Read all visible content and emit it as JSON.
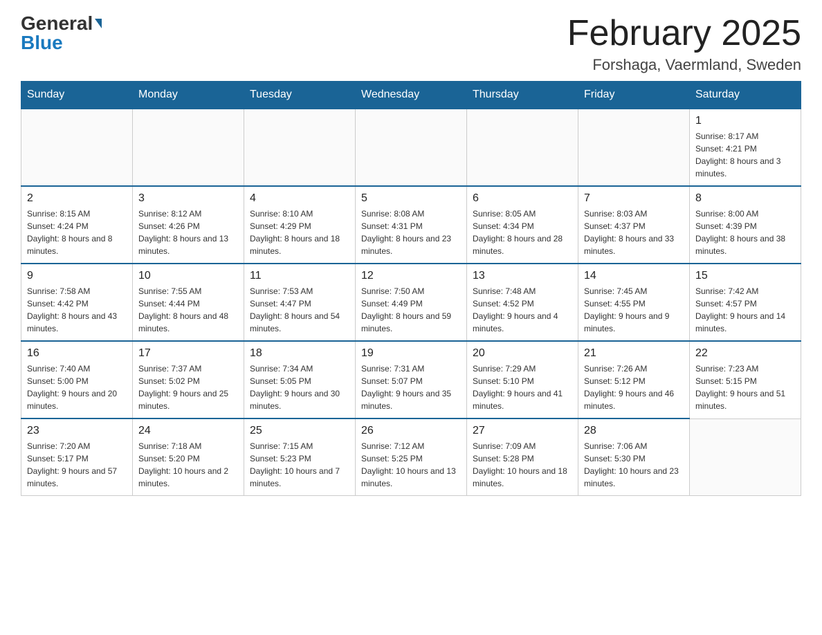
{
  "logo": {
    "general": "General",
    "blue": "Blue"
  },
  "title": "February 2025",
  "location": "Forshaga, Vaermland, Sweden",
  "days_of_week": [
    "Sunday",
    "Monday",
    "Tuesday",
    "Wednesday",
    "Thursday",
    "Friday",
    "Saturday"
  ],
  "weeks": [
    [
      {
        "day": "",
        "info": ""
      },
      {
        "day": "",
        "info": ""
      },
      {
        "day": "",
        "info": ""
      },
      {
        "day": "",
        "info": ""
      },
      {
        "day": "",
        "info": ""
      },
      {
        "day": "",
        "info": ""
      },
      {
        "day": "1",
        "info": "Sunrise: 8:17 AM\nSunset: 4:21 PM\nDaylight: 8 hours and 3 minutes."
      }
    ],
    [
      {
        "day": "2",
        "info": "Sunrise: 8:15 AM\nSunset: 4:24 PM\nDaylight: 8 hours and 8 minutes."
      },
      {
        "day": "3",
        "info": "Sunrise: 8:12 AM\nSunset: 4:26 PM\nDaylight: 8 hours and 13 minutes."
      },
      {
        "day": "4",
        "info": "Sunrise: 8:10 AM\nSunset: 4:29 PM\nDaylight: 8 hours and 18 minutes."
      },
      {
        "day": "5",
        "info": "Sunrise: 8:08 AM\nSunset: 4:31 PM\nDaylight: 8 hours and 23 minutes."
      },
      {
        "day": "6",
        "info": "Sunrise: 8:05 AM\nSunset: 4:34 PM\nDaylight: 8 hours and 28 minutes."
      },
      {
        "day": "7",
        "info": "Sunrise: 8:03 AM\nSunset: 4:37 PM\nDaylight: 8 hours and 33 minutes."
      },
      {
        "day": "8",
        "info": "Sunrise: 8:00 AM\nSunset: 4:39 PM\nDaylight: 8 hours and 38 minutes."
      }
    ],
    [
      {
        "day": "9",
        "info": "Sunrise: 7:58 AM\nSunset: 4:42 PM\nDaylight: 8 hours and 43 minutes."
      },
      {
        "day": "10",
        "info": "Sunrise: 7:55 AM\nSunset: 4:44 PM\nDaylight: 8 hours and 48 minutes."
      },
      {
        "day": "11",
        "info": "Sunrise: 7:53 AM\nSunset: 4:47 PM\nDaylight: 8 hours and 54 minutes."
      },
      {
        "day": "12",
        "info": "Sunrise: 7:50 AM\nSunset: 4:49 PM\nDaylight: 8 hours and 59 minutes."
      },
      {
        "day": "13",
        "info": "Sunrise: 7:48 AM\nSunset: 4:52 PM\nDaylight: 9 hours and 4 minutes."
      },
      {
        "day": "14",
        "info": "Sunrise: 7:45 AM\nSunset: 4:55 PM\nDaylight: 9 hours and 9 minutes."
      },
      {
        "day": "15",
        "info": "Sunrise: 7:42 AM\nSunset: 4:57 PM\nDaylight: 9 hours and 14 minutes."
      }
    ],
    [
      {
        "day": "16",
        "info": "Sunrise: 7:40 AM\nSunset: 5:00 PM\nDaylight: 9 hours and 20 minutes."
      },
      {
        "day": "17",
        "info": "Sunrise: 7:37 AM\nSunset: 5:02 PM\nDaylight: 9 hours and 25 minutes."
      },
      {
        "day": "18",
        "info": "Sunrise: 7:34 AM\nSunset: 5:05 PM\nDaylight: 9 hours and 30 minutes."
      },
      {
        "day": "19",
        "info": "Sunrise: 7:31 AM\nSunset: 5:07 PM\nDaylight: 9 hours and 35 minutes."
      },
      {
        "day": "20",
        "info": "Sunrise: 7:29 AM\nSunset: 5:10 PM\nDaylight: 9 hours and 41 minutes."
      },
      {
        "day": "21",
        "info": "Sunrise: 7:26 AM\nSunset: 5:12 PM\nDaylight: 9 hours and 46 minutes."
      },
      {
        "day": "22",
        "info": "Sunrise: 7:23 AM\nSunset: 5:15 PM\nDaylight: 9 hours and 51 minutes."
      }
    ],
    [
      {
        "day": "23",
        "info": "Sunrise: 7:20 AM\nSunset: 5:17 PM\nDaylight: 9 hours and 57 minutes."
      },
      {
        "day": "24",
        "info": "Sunrise: 7:18 AM\nSunset: 5:20 PM\nDaylight: 10 hours and 2 minutes."
      },
      {
        "day": "25",
        "info": "Sunrise: 7:15 AM\nSunset: 5:23 PM\nDaylight: 10 hours and 7 minutes."
      },
      {
        "day": "26",
        "info": "Sunrise: 7:12 AM\nSunset: 5:25 PM\nDaylight: 10 hours and 13 minutes."
      },
      {
        "day": "27",
        "info": "Sunrise: 7:09 AM\nSunset: 5:28 PM\nDaylight: 10 hours and 18 minutes."
      },
      {
        "day": "28",
        "info": "Sunrise: 7:06 AM\nSunset: 5:30 PM\nDaylight: 10 hours and 23 minutes."
      },
      {
        "day": "",
        "info": ""
      }
    ]
  ]
}
